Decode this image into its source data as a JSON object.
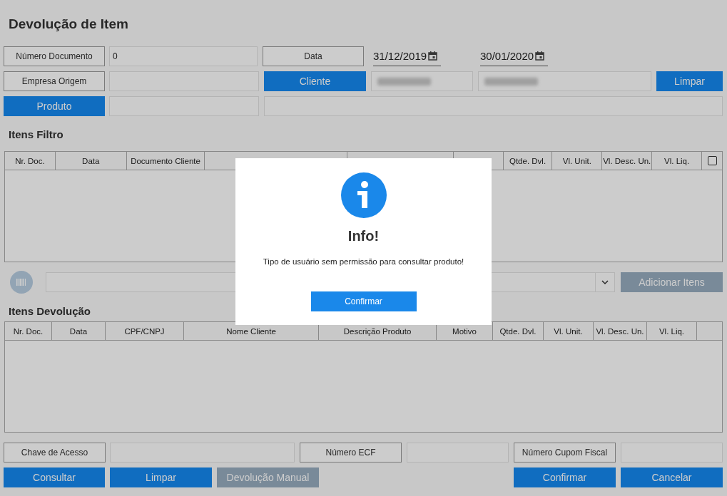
{
  "title": "Devolução de Item",
  "form_rows": [
    [
      {
        "kind": "label",
        "text": "Número Documento"
      },
      {
        "kind": "field",
        "value": "0"
      },
      {
        "kind": "label",
        "text": "Data"
      },
      {
        "kind": "date",
        "value": "31/12/2019"
      },
      {
        "kind": "date",
        "value": "30/01/2020"
      }
    ],
    [
      {
        "kind": "label",
        "text": "Empresa Origem"
      },
      {
        "kind": "field"
      },
      {
        "kind": "button",
        "text": "Cliente",
        "disabled": false
      },
      {
        "kind": "field",
        "redacted": true
      },
      {
        "kind": "field",
        "redacted": true
      },
      {
        "kind": "button",
        "text": "Limpar",
        "disabled": false
      }
    ],
    [
      {
        "kind": "button",
        "text": "Produto",
        "disabled": false
      },
      {
        "kind": "field"
      },
      {
        "kind": "field"
      }
    ]
  ],
  "filter_section": {
    "title": "Itens Filtro",
    "columns": [
      {
        "kind": "text",
        "label": "Nr. Doc."
      },
      {
        "kind": "text",
        "label": "Data"
      },
      {
        "kind": "text",
        "label": "Documento Cliente"
      },
      {
        "kind": "text"
      },
      {
        "kind": "text"
      },
      {
        "kind": "text"
      },
      {
        "kind": "text",
        "label": "Qtde. Dvl."
      },
      {
        "kind": "text",
        "label": "Vl. Unit."
      },
      {
        "kind": "text",
        "label": "Vl. Desc. Un."
      },
      {
        "kind": "text",
        "label": "Vl. Liq."
      },
      {
        "kind": "checkbox",
        "checked": false
      }
    ]
  },
  "add_bar": {
    "button": {
      "text": "Adicionar Itens",
      "disabled": true
    }
  },
  "return_section": {
    "title": "Itens Devolução",
    "columns": [
      {
        "kind": "text",
        "label": "Nr. Doc."
      },
      {
        "kind": "text",
        "label": "Data"
      },
      {
        "kind": "text",
        "label": "CPF/CNPJ"
      },
      {
        "kind": "text",
        "label": "Nome Cliente"
      },
      {
        "kind": "text",
        "label": "Descrição Produto"
      },
      {
        "kind": "text",
        "label": "Motivo"
      },
      {
        "kind": "text",
        "label": "Qtde. Dvl."
      },
      {
        "kind": "text",
        "label": "Vl. Unit."
      },
      {
        "kind": "text",
        "label": "Vl. Desc. Un."
      },
      {
        "kind": "text",
        "label": "Vl. Liq."
      },
      {
        "kind": "text"
      }
    ]
  },
  "bottom_rows": [
    [
      {
        "kind": "label",
        "text": "Chave de Acesso"
      },
      {
        "kind": "field"
      },
      {
        "kind": "label",
        "text": "Número ECF"
      },
      {
        "kind": "field"
      },
      {
        "kind": "label",
        "text": "Número Cupom Fiscal"
      },
      {
        "kind": "field"
      }
    ],
    [
      {
        "kind": "button",
        "text": "Consultar",
        "disabled": false
      },
      {
        "kind": "button",
        "text": "Limpar",
        "disabled": false
      },
      {
        "kind": "button",
        "text": "Devolução Manual",
        "disabled": true
      },
      {
        "kind": "button",
        "text": "Confirmar",
        "disabled": false
      },
      {
        "kind": "button",
        "text": "Cancelar",
        "disabled": false
      }
    ]
  ],
  "dialog": {
    "title": "Info!",
    "message": "Tipo de usuário sem permissão para consultar produto!",
    "button": "Confirmar"
  }
}
